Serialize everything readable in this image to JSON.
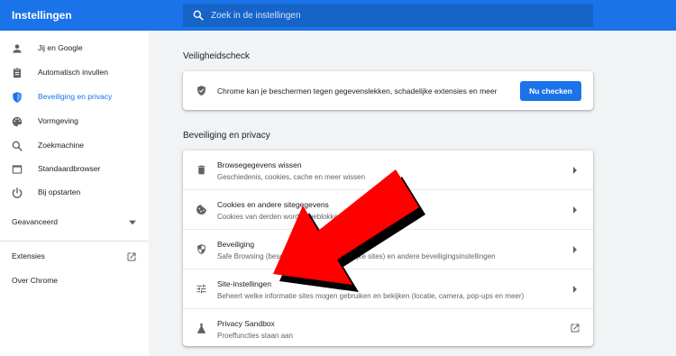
{
  "header": {
    "title": "Instellingen",
    "search_placeholder": "Zoek in de instellingen"
  },
  "sidebar": {
    "items": [
      {
        "label": "Jij en Google",
        "icon": "person-icon"
      },
      {
        "label": "Automatisch invullen",
        "icon": "clipboard-icon"
      },
      {
        "label": "Beveiliging en privacy",
        "icon": "shield-icon",
        "active": true
      },
      {
        "label": "Vormgeving",
        "icon": "palette-icon"
      },
      {
        "label": "Zoekmachine",
        "icon": "search-icon"
      },
      {
        "label": "Standaardbrowser",
        "icon": "browser-icon"
      },
      {
        "label": "Bij opstarten",
        "icon": "power-icon"
      }
    ],
    "advanced_label": "Geavanceerd",
    "extensions_label": "Extensies",
    "about_label": "Over Chrome"
  },
  "safety_check": {
    "section_title": "Veiligheidscheck",
    "text": "Chrome kan je beschermen tegen gegevenslekken, schadelijke extensies en meer",
    "button_label": "Nu checken"
  },
  "privacy": {
    "section_title": "Beveiliging en privacy",
    "rows": [
      {
        "title": "Browsegegevens wissen",
        "subtitle": "Geschiedenis, cookies, cache en meer wissen",
        "icon": "trash-icon"
      },
      {
        "title": "Cookies en andere sitegegevens",
        "subtitle": "Cookies van derden worden geblokkeerd in de incognitomodus",
        "icon": "cookie-icon"
      },
      {
        "title": "Beveiliging",
        "subtitle": "Safe Browsing (bescherming tegen gevaarlijke sites) en andere beveiligingsinstellingen",
        "icon": "security-shield-icon"
      },
      {
        "title": "Site-instellingen",
        "subtitle": "Beheert welke informatie sites mogen gebruiken en bekijken (locatie, camera, pop-ups en meer)",
        "icon": "tune-icon"
      },
      {
        "title": "Privacy Sandbox",
        "subtitle": "Proeffuncties staan aan",
        "icon": "flask-icon"
      }
    ]
  },
  "colors": {
    "accent": "#1a73e8",
    "arrow": "#ff0000"
  }
}
